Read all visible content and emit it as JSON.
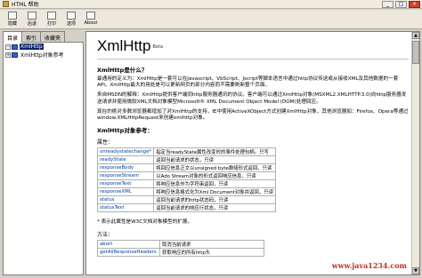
{
  "window": {
    "title": "HTML 帮助",
    "buttons": [
      "_",
      "□",
      "×"
    ]
  },
  "toolbar": {
    "items": [
      {
        "label": "隐藏",
        "icon": "hide-icon"
      },
      {
        "label": "后退",
        "icon": "back-icon"
      },
      {
        "label": "打印",
        "icon": "print-icon"
      },
      {
        "label": "选项",
        "icon": "options-icon"
      },
      {
        "label": "About",
        "icon": "about-icon"
      }
    ]
  },
  "nav": {
    "tabs": [
      "目录",
      "索引",
      "收藏夹"
    ],
    "tree": [
      {
        "label": "XmlHttp",
        "selected": true
      },
      {
        "label": "XmlHttp对象参考",
        "selected": false
      }
    ]
  },
  "content": {
    "title": "XmlHttp",
    "title_badge": "Beta",
    "heading_what": "XmlHttp是什么？",
    "para1": "最通用的定义为：XmlHttp是一套可以在Javascript、VbScript、Jscript等脚本语言中通过http协议传送或从接收XML及其他数据的一套API。XmlHttp最大的用处是可以更新网页的部分内容而不需要刷新整个页面。",
    "para2": "来自MSDN的解释：XmlHttp提供客户端同http服务器通讯的协议。客户端可以通过XmlHttp对象(MSXML2.XMLHTTP.3.0)向http服务器发送请求并使用微软XML文档对象模型Microsoft® XML Document Object Model (DOM)处理回应。",
    "para3": "现在的绝对多数浏览器都增加了对XmlHttp的支持，IE中使用ActiveXObject方式创建XmlHttp对象，其他浏览器如：Firefox、Opera等通过window.XMLHttpRequest来创建xmlhttp对象。",
    "heading_ref": "XmlHttp对象参考：",
    "props_title": "属性：",
    "properties": [
      {
        "name": "onreadystatechange*",
        "desc": "指定当readyState属性改变时的事件处理句柄。只写"
      },
      {
        "name": "readyState",
        "desc": "返回当前请求的状态，只读"
      },
      {
        "name": "responseBody",
        "desc": "将回应信息正文以unsigned byte数组形式返回，只读"
      },
      {
        "name": "responseStream",
        "desc": "以Ado Stream对象的形式返回响应信息，只读"
      },
      {
        "name": "responseText",
        "desc": "将响应信息作为字符串返回，只读"
      },
      {
        "name": "responseXML",
        "desc": "将响应信息格式化为Xml Document对象并返回，只读"
      },
      {
        "name": "status",
        "desc": "返回当前请求的http状态码，只读"
      },
      {
        "name": "statusText",
        "desc": "返回当前请求的响应行状态，只读"
      }
    ],
    "note": "* 表示此属性是W3C文档对象模型的扩展。",
    "methods_title": "方法：",
    "methods": [
      {
        "name": "abort",
        "desc": "取消当前请求"
      },
      {
        "name": "getAllResponseHeaders",
        "desc": "获取响应的所有http头"
      }
    ]
  },
  "watermark": "www.java1234.com"
}
